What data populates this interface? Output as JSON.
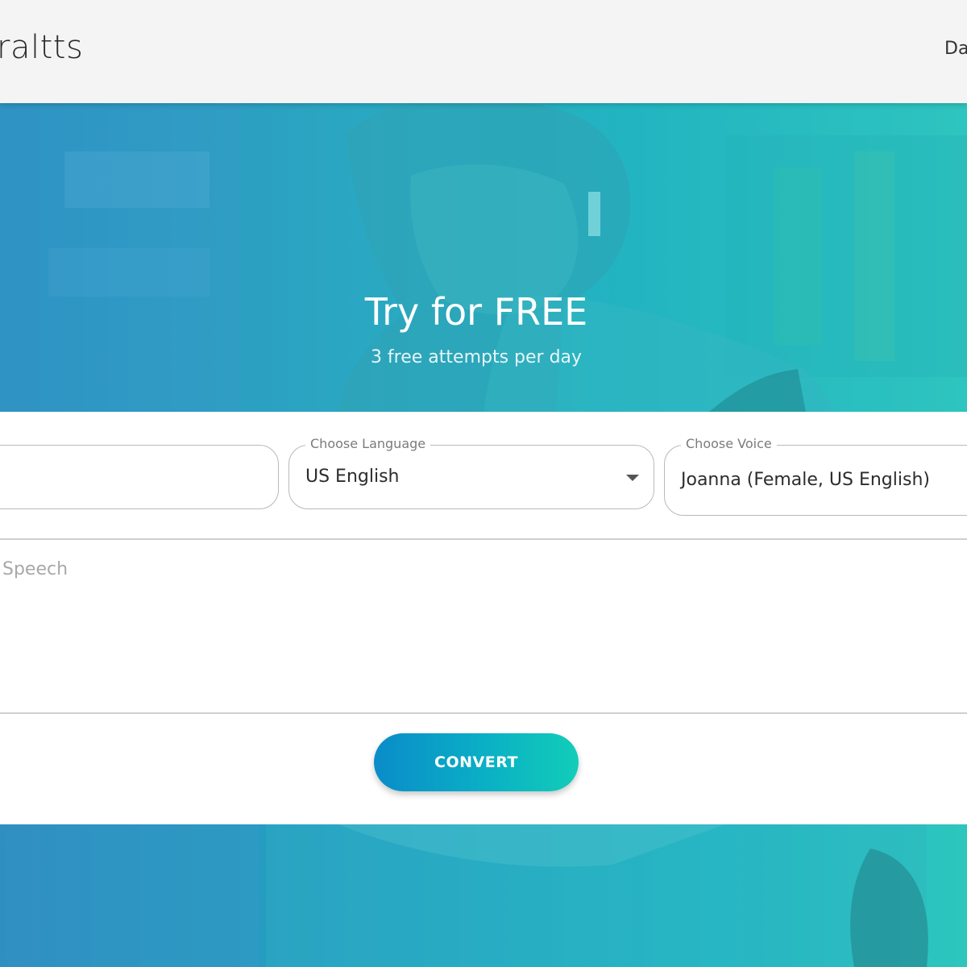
{
  "header": {
    "logo_text": "raltts",
    "nav_link": "Da"
  },
  "hero": {
    "title": "Try for FREE",
    "subtitle": "3 free attempts per day"
  },
  "form": {
    "language": {
      "label": "Choose Language",
      "value": "US English"
    },
    "voice": {
      "label": "Choose Voice",
      "value": "Joanna (Female, US English)"
    },
    "text_placeholder": "Speech",
    "convert_label": "CONVERT"
  },
  "colors": {
    "accent_start": "#0a8cc9",
    "accent_end": "#12cdb8",
    "hero_teal": "#22b4c1"
  }
}
